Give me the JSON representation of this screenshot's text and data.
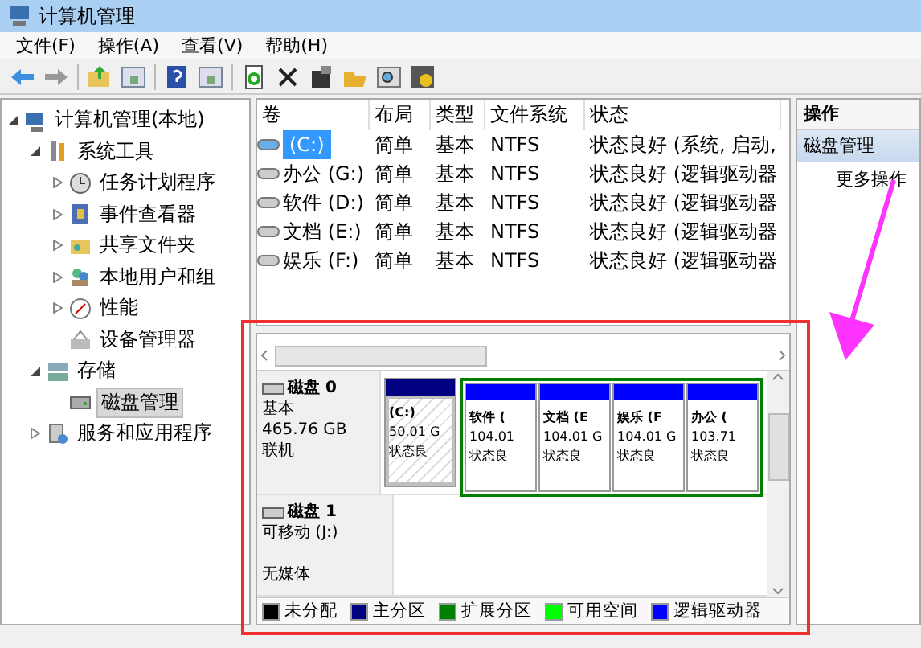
{
  "window": {
    "title": "计算机管理"
  },
  "menu": [
    "文件(F)",
    "操作(A)",
    "查看(V)",
    "帮助(H)"
  ],
  "tree": [
    {
      "label": "计算机管理(本地)",
      "selected": false,
      "expanded": true,
      "children": [
        {
          "label": "系统工具",
          "selected": false,
          "expanded": true,
          "children": [
            {
              "label": "任务计划程序",
              "selected": false,
              "expanded": false
            },
            {
              "label": "事件查看器",
              "selected": false,
              "expanded": false
            },
            {
              "label": "共享文件夹",
              "selected": false,
              "expanded": false
            },
            {
              "label": "本地用户和组",
              "selected": false,
              "expanded": false
            },
            {
              "label": "性能",
              "selected": false,
              "expanded": false
            },
            {
              "label": "设备管理器",
              "selected": false
            }
          ]
        },
        {
          "label": "存储",
          "selected": false,
          "expanded": true,
          "children": [
            {
              "label": "磁盘管理",
              "selected": true
            }
          ]
        },
        {
          "label": "服务和应用程序",
          "selected": false,
          "expanded": false
        }
      ]
    }
  ],
  "table": {
    "columns": [
      "卷",
      "布局",
      "类型",
      "文件系统",
      "状态"
    ],
    "rows": [
      {
        "cells": [
          "(C:)",
          "简单",
          "基本",
          "NTFS",
          "状态良好 (系统, 启动,"
        ],
        "selected": true
      },
      {
        "cells": [
          "办公 (G:)",
          "简单",
          "基本",
          "NTFS",
          "状态良好 (逻辑驱动器"
        ],
        "selected": false
      },
      {
        "cells": [
          "软件 (D:)",
          "简单",
          "基本",
          "NTFS",
          "状态良好 (逻辑驱动器"
        ],
        "selected": false
      },
      {
        "cells": [
          "文档 (E:)",
          "简单",
          "基本",
          "NTFS",
          "状态良好 (逻辑驱动器"
        ],
        "selected": false
      },
      {
        "cells": [
          "娱乐 (F:)",
          "简单",
          "基本",
          "NTFS",
          "状态良好 (逻辑驱动器"
        ],
        "selected": false
      }
    ]
  },
  "disks": [
    {
      "name": "磁盘 0",
      "lines": [
        "基本",
        "465.76 GB",
        "联机"
      ],
      "partitions": [
        {
          "kind": "primary",
          "name": "(C:)",
          "size": "50.01 G",
          "status": "状态良"
        },
        {
          "kind": "logical",
          "name": "软件 (",
          "size": "104.01",
          "status": "状态良"
        },
        {
          "kind": "logical",
          "name": "文档 (E",
          "size": "104.01 G",
          "status": "状态良"
        },
        {
          "kind": "logical",
          "name": "娱乐 (F",
          "size": "104.01 G",
          "status": "状态良"
        },
        {
          "kind": "logical",
          "name": "办公 (",
          "size": "103.71",
          "status": "状态良"
        }
      ]
    },
    {
      "name": "磁盘 1",
      "lines": [
        "可移动 (J:)",
        "无媒体"
      ]
    }
  ],
  "legend": [
    {
      "label": "未分配",
      "color": "#000000"
    },
    {
      "label": "主分区",
      "color": "#000080"
    },
    {
      "label": "扩展分区",
      "color": "#008000"
    },
    {
      "label": "可用空间",
      "color": "#00ff00"
    },
    {
      "label": "逻辑驱动器",
      "color": "#0000ff"
    }
  ],
  "actions": {
    "header": "操作",
    "section": "磁盘管理",
    "items": [
      "更多操作"
    ]
  }
}
